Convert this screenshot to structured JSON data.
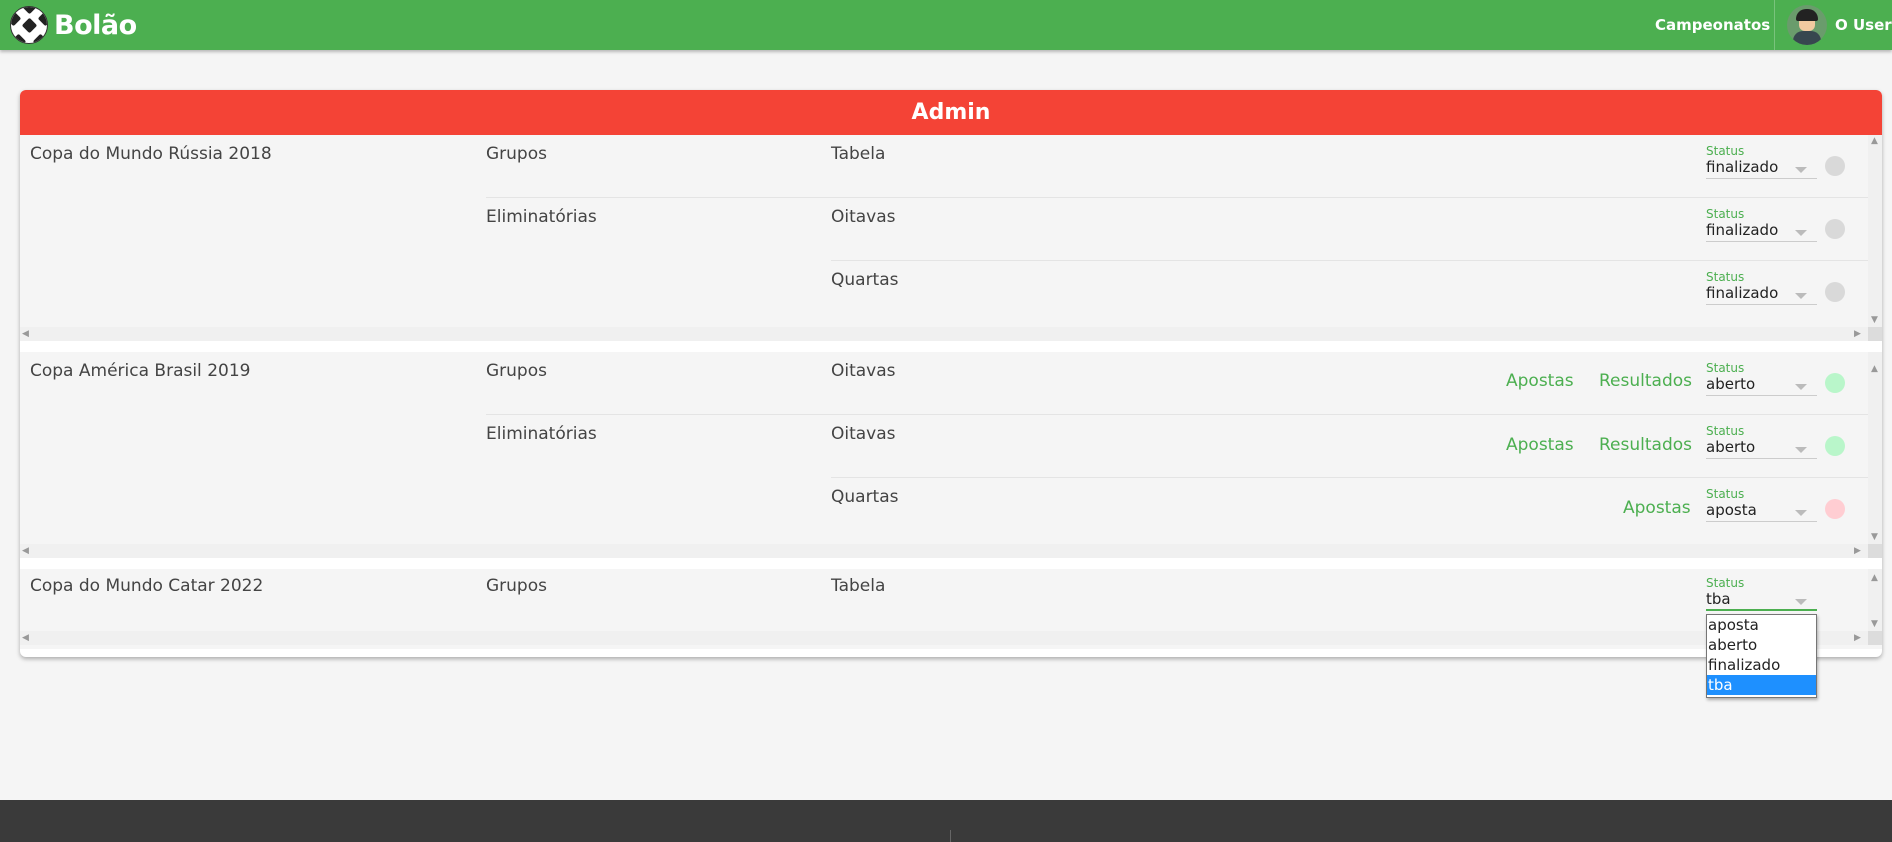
{
  "header": {
    "brand": "Bolão",
    "nav_campeonatos": "Campeonatos",
    "user_name": "O User"
  },
  "admin": {
    "title": "Admin",
    "status_label": "Status",
    "championships": [
      {
        "name": "Copa do Mundo Rússia 2018",
        "rows": [
          {
            "phase": "Grupos",
            "stage": "Tabela",
            "status": "finalizado",
            "indicator": "#d9d9d9"
          },
          {
            "phase": "Eliminatórias",
            "stage": "Oitavas",
            "status": "finalizado",
            "indicator": "#d9d9d9"
          },
          {
            "phase": "",
            "stage": "Quartas",
            "status": "finalizado",
            "indicator": "#d9d9d9"
          }
        ]
      },
      {
        "name": "Copa América Brasil 2019",
        "rows": [
          {
            "phase": "Grupos",
            "stage": "Oitavas",
            "apostas": "Apostas",
            "resultados": "Resultados",
            "status": "aberto",
            "indicator": "#b9f6ca"
          },
          {
            "phase": "Eliminatórias",
            "stage": "Oitavas",
            "apostas": "Apostas",
            "resultados": "Resultados",
            "status": "aberto",
            "indicator": "#b9f6ca"
          },
          {
            "phase": "",
            "stage": "Quartas",
            "apostas": "Apostas",
            "status": "aposta",
            "indicator": "#ffcdd2"
          }
        ]
      },
      {
        "name": "Copa do Mundo Catar 2022",
        "rows": [
          {
            "phase": "Grupos",
            "stage": "Tabela",
            "status": "tba"
          }
        ]
      }
    ],
    "status_options": [
      "aposta",
      "aberto",
      "finalizado",
      "tba"
    ],
    "selected_option": "tba"
  },
  "colors": {
    "primary": "#4caf50",
    "header_red": "#f44336",
    "footer": "#3a3a3a"
  }
}
